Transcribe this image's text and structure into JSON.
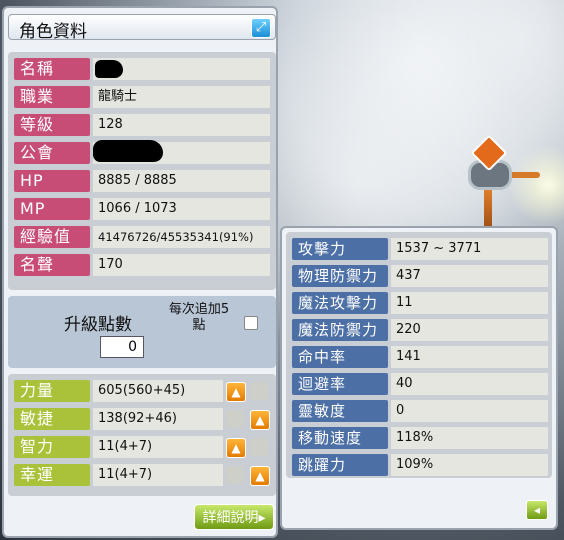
{
  "window": {
    "title": "角色資料",
    "title_icon": "expand-icon"
  },
  "profile": [
    {
      "label": "名稱",
      "value": "",
      "redacted": true
    },
    {
      "label": "職業",
      "value": "龍騎士"
    },
    {
      "label": "等級",
      "value": "128"
    },
    {
      "label": "公會",
      "value": "",
      "redacted": true
    },
    {
      "label": "HP",
      "value": "8885 / 8885"
    },
    {
      "label": "MP",
      "value": "1066 / 1073"
    },
    {
      "label": "經驗值",
      "value": "41476726/45535341(91%)"
    },
    {
      "label": "名聲",
      "value": "170"
    }
  ],
  "points": {
    "label": "升級點數",
    "value": "0",
    "auto_label_1": "每次追加5",
    "auto_label_2": "點"
  },
  "stats": [
    {
      "label": "力量",
      "value": "605(560+45)",
      "button": "left"
    },
    {
      "label": "敏捷",
      "value": "138(92+46)",
      "button": "right"
    },
    {
      "label": "智力",
      "value": "11(4+7)",
      "button": "left"
    },
    {
      "label": "幸運",
      "value": "11(4+7)",
      "button": "right"
    }
  ],
  "detail_button": "詳細說明▸",
  "details": [
    {
      "label": "攻擊力",
      "value": "1537 ~ 3771"
    },
    {
      "label": "物理防禦力",
      "value": "437"
    },
    {
      "label": "魔法攻擊力",
      "value": "11"
    },
    {
      "label": "魔法防禦力",
      "value": "220"
    },
    {
      "label": "命中率",
      "value": "141"
    },
    {
      "label": "迴避率",
      "value": "40"
    },
    {
      "label": "靈敏度",
      "value": "0"
    },
    {
      "label": "移動速度",
      "value": "118%"
    },
    {
      "label": "跳躍力",
      "value": "109%"
    }
  ],
  "colors": {
    "profile_label": "#c84d76",
    "stat_label": "#a9c23a",
    "detail_label": "#4c6fa6",
    "up_button": "#f39a1a"
  }
}
